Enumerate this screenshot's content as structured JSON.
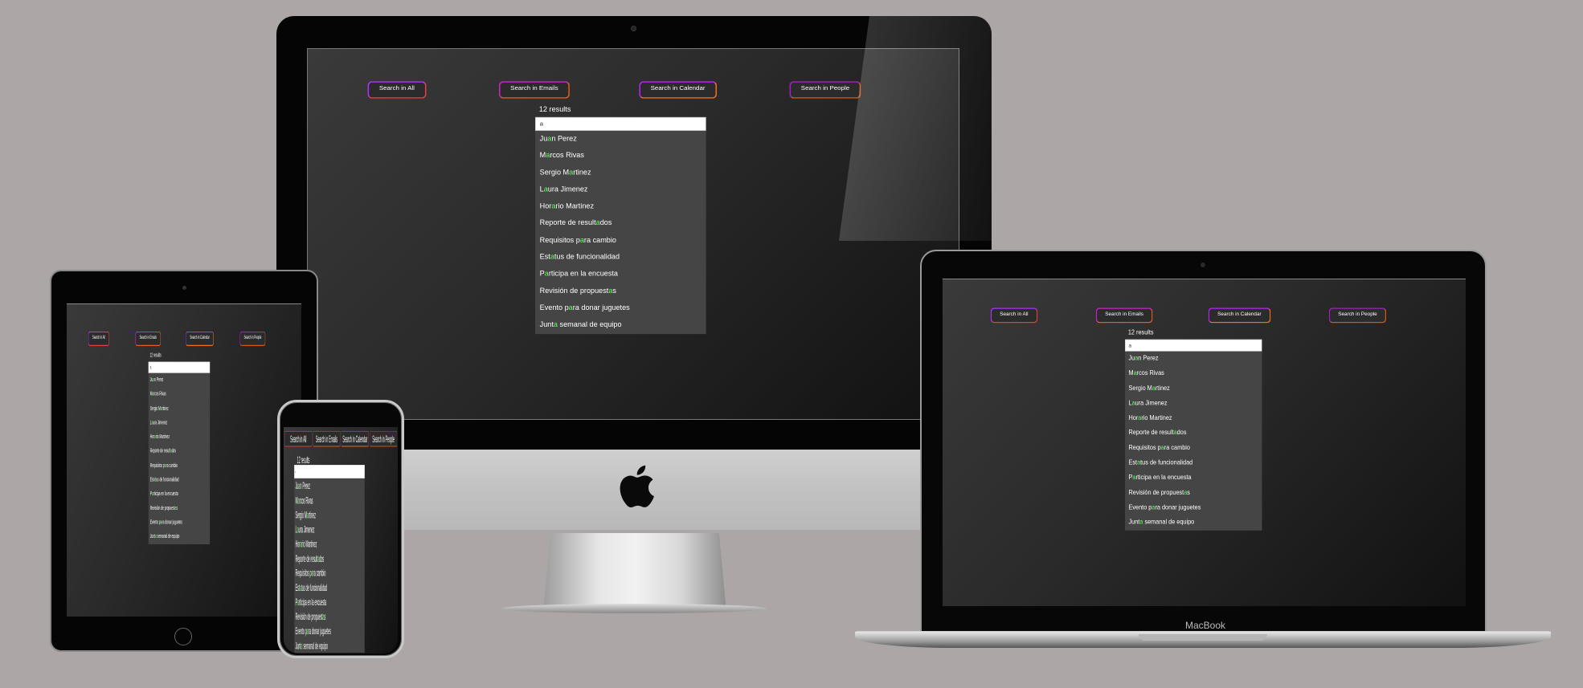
{
  "app": {
    "buttons": [
      "Search in All",
      "Search in Emails",
      "Search in Calendar",
      "Search in People"
    ],
    "results_label": "12 results",
    "search_value": "a",
    "items": [
      {
        "pre": "Ju",
        "hl": "a",
        "post": "n Perez"
      },
      {
        "pre": "M",
        "hl": "a",
        "post": "rcos Rivas"
      },
      {
        "pre": "Sergio M",
        "hl": "a",
        "post": "rtinez"
      },
      {
        "pre": "L",
        "hl": "a",
        "post": "ura Jimenez"
      },
      {
        "pre": "Hor",
        "hl": "a",
        "post": "rio Martinez"
      },
      {
        "pre": "Reporte de result",
        "hl": "a",
        "post": "dos"
      },
      {
        "pre": "Requisitos p",
        "hl": "a",
        "post": "ra cambio"
      },
      {
        "pre": "Est",
        "hl": "a",
        "post": "tus de funcionalidad"
      },
      {
        "pre": "P",
        "hl": "a",
        "post": "rticipa en la encuesta"
      },
      {
        "pre": "Revisión de propuest",
        "hl": "a",
        "post": "s"
      },
      {
        "pre": "Evento p",
        "hl": "a",
        "post": "ra donar juguetes"
      },
      {
        "pre": "Junt",
        "hl": "a",
        "post": " semanal de equipo"
      }
    ]
  },
  "devices": {
    "laptop_label": "MacBook"
  },
  "colors": {
    "background": "#aca6a6",
    "highlight": "#5dff5d",
    "list_bg": "#454545"
  },
  "icons": {
    "apple_logo": "apple-logo-icon"
  }
}
